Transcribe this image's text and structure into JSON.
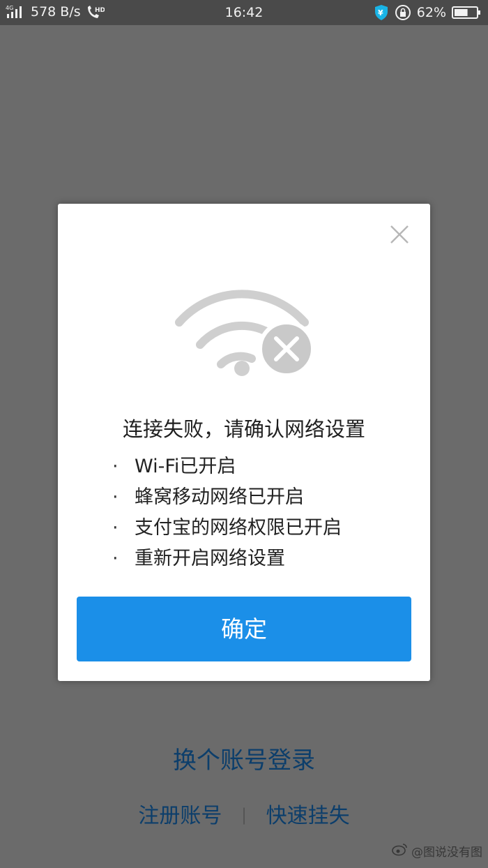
{
  "status_bar": {
    "network": "4G",
    "speed": "578 B/s",
    "call_badge": "HD",
    "time": "16:42",
    "battery": "62%",
    "battery_level": 0.62
  },
  "dialog": {
    "title": "连接失败，请确认网络设置",
    "bullet": "·",
    "reasons": [
      "Wi-Fi已开启",
      "蜂窝移动网络已开启",
      "支付宝的网络权限已开启",
      "重新开启网络设置"
    ],
    "confirm_label": "确定"
  },
  "login": {
    "switch_account": "换个账号登录",
    "register": "注册账号",
    "separator": "|",
    "report_loss": "快速挂失"
  },
  "watermark": "@图说没有图",
  "colors": {
    "accent": "#1b8fe8",
    "link": "#0c3e6b",
    "overlay": "#6b6b6b"
  }
}
